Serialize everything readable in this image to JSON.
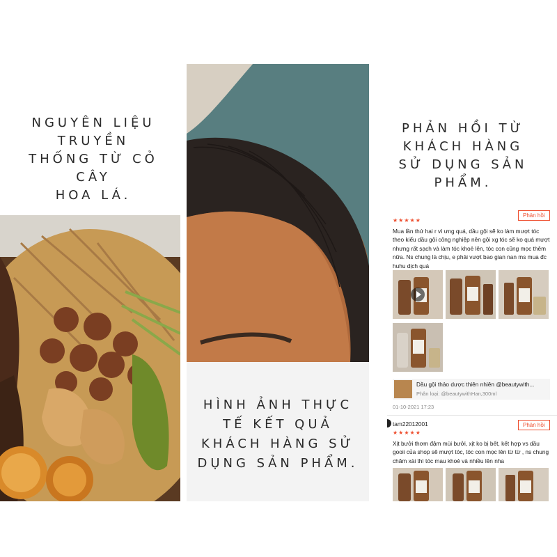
{
  "headings": {
    "left": "NGUYÊN LIỆU\nTRUYỀN\nTHỐNG TỪ CỎ\nCÂY\nHOA LÁ.",
    "right": "PHẢN HỒI TỪ\nKHÁCH HÀNG\nSỬ DỤNG SẢN\nPHẨM.",
    "middle": "HÌNH ẢNH THỰC\nTẾ KẾT QUẢ\nKHÁCH HÀNG SỬ\nDỤNG SẢN PHẨM."
  },
  "reviews": {
    "reply_label": "Phản hồi",
    "stars": "★★★★★",
    "items": [
      {
        "text": "Mua lần thứ hai r vì ưng quá, dầu gội sẽ ko làm mượt tóc theo kiểu dầu gội công nghiệp nên gội xg tóc sẽ ko quá mượt nhưng rất sạch và làm tóc khoẻ lên, tóc con cũng mọc thêm nữa. Ns chung là chịu, e phải vượt bao gian nan ms mua đc huhu dịch quá",
        "product_name": "Dầu gội thảo dược thiên nhiên @beautywith...",
        "variant": "Phân loại: @beautywithHan,300ml",
        "date": "01-10-2021 17:23"
      },
      {
        "username": "tam22012001",
        "text": "Xịt bưởi thơm đậm mùi bưởi, xịt ko bị bết, kết hợp vs dầu gooii của shop sẽ mượt tóc, tóc con mọc lên từ từ , ns chung chăm xài thì tóc mau khoẻ và nhiều lên nha"
      }
    ]
  },
  "colors": {
    "accent": "#ee4d2d",
    "portrait_bg": "#587e80",
    "heading_text": "#2a2a2a"
  }
}
